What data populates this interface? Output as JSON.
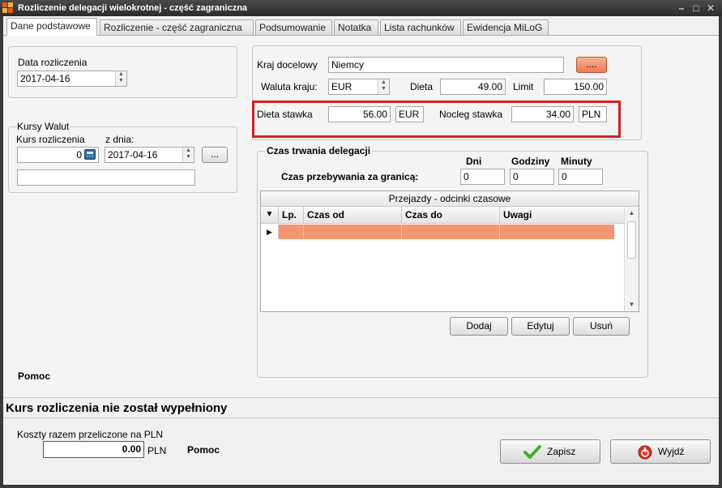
{
  "window": {
    "title": "Rozliczenie delegacji wielokrotnej - część zagraniczna"
  },
  "tabs": [
    {
      "label": "Dane podstawowe",
      "active": true
    },
    {
      "label": "Rozliczenie - część zagraniczna",
      "active": false
    },
    {
      "label": "Podsumowanie",
      "active": false
    },
    {
      "label": "Notatka",
      "active": false
    },
    {
      "label": "Lista rachunków",
      "active": false
    },
    {
      "label": "Ewidencja MiLoG",
      "active": false
    }
  ],
  "settlement": {
    "date_label": "Data rozliczenia",
    "date_value": "2017-04-16"
  },
  "exchange": {
    "group_label": "Kursy Walut",
    "rate_label": "Kurs rozliczenia",
    "rate_value": "0",
    "from_date_label": "z dnia:",
    "from_date_value": "2017-04-16",
    "browse_label": "...",
    "extra_value": ""
  },
  "help_label_left": "Pomoc",
  "destination": {
    "country_label": "Kraj docelowy",
    "country_value": "Niemcy",
    "country_button": "....",
    "currency_label": "Waluta kraju:",
    "currency_value": "EUR",
    "diet_label": "Dieta",
    "diet_value": "49.00",
    "limit_label": "Limit",
    "limit_value": "150.00",
    "diet_rate_label": "Dieta stawka",
    "diet_rate_value": "56.00",
    "diet_rate_currency": "EUR",
    "lodging_rate_label": "Nocleg stawka",
    "lodging_rate_value": "34.00",
    "lodging_rate_currency": "PLN"
  },
  "duration": {
    "group_label": "Czas trwania delegacji",
    "days_label": "Dni",
    "hours_label": "Godziny",
    "minutes_label": "Minuty",
    "abroad_label": "Czas przebywania za granicą:",
    "days_value": "0",
    "hours_value": "0",
    "minutes_value": "0"
  },
  "trips": {
    "caption": "Przejazdy - odcinki czasowe",
    "columns": [
      "Lp.",
      "Czas od",
      "Czas do",
      "Uwagi"
    ],
    "add_button": "Dodaj",
    "edit_button": "Edytuj",
    "delete_button": "Usuń"
  },
  "status_message": "Kurs  rozliczenia nie został wypełniony",
  "total": {
    "label": "Koszty razem przeliczone na PLN",
    "value": "0.00",
    "currency": "PLN",
    "help_label": "Pomoc"
  },
  "actions": {
    "save_label": "Zapisz",
    "exit_label": "Wyjdź"
  },
  "colors": {
    "highlight_row": "#f39670",
    "annotation_box": "#d42020",
    "save_icon": "#3fae2a",
    "exit_icon": "#d9331f"
  }
}
